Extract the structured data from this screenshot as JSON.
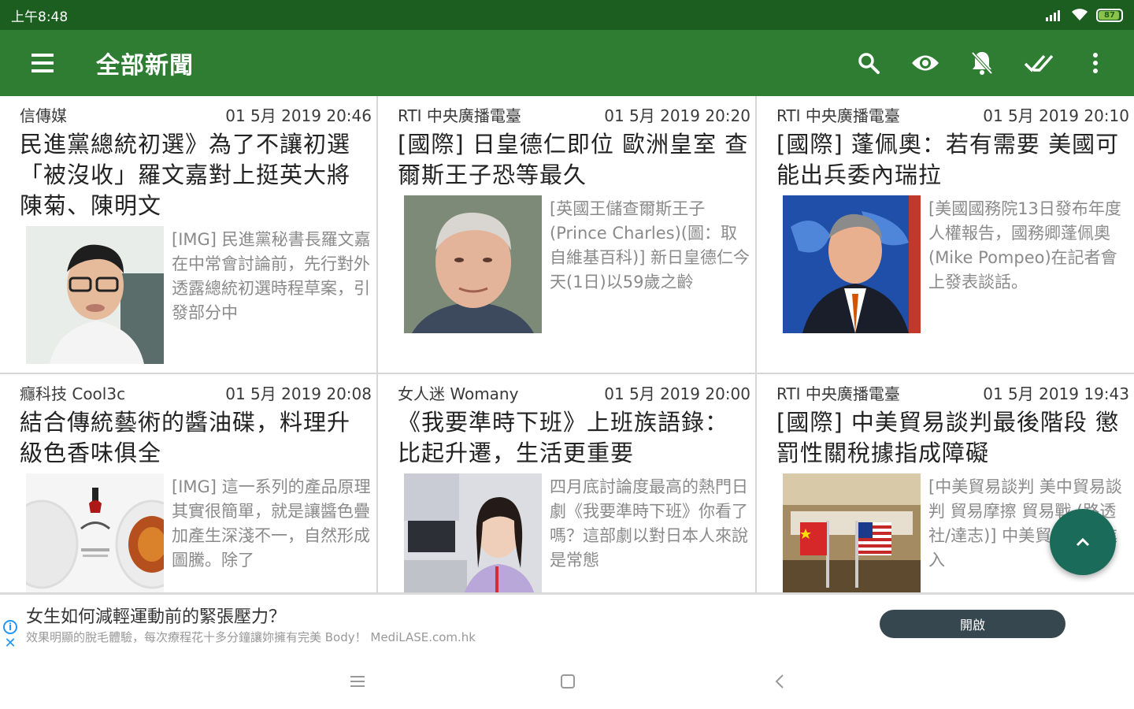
{
  "status_bar": {
    "time": "上午8:48",
    "battery": "87"
  },
  "app_bar": {
    "title": "全部新聞",
    "actions": [
      "search-icon",
      "eye-icon",
      "notifications-off-icon",
      "done-all-icon",
      "more-vert-icon"
    ]
  },
  "articles": [
    {
      "source": "信傳媒",
      "date": "01 5月 2019 20:46",
      "title": "民進黨總統初選》為了不讓初選「被沒收」羅文嘉對上挺英大將陳菊、陳明文",
      "snippet": "[IMG] 民進黨秘書長羅文嘉在中常會討論前，先行對外透露總統初選時程草案，引發部分中"
    },
    {
      "source": "RTI 中央廣播電臺",
      "date": "01 5月 2019 20:20",
      "title": "[國際] 日皇德仁即位 歐洲皇室 查爾斯王子恐等最久",
      "snippet": "[英國王儲查爾斯王子(Prince Charles)(圖：取自維基百科)] 新日皇德仁今天(1日)以59歲之齡"
    },
    {
      "source": "RTI 中央廣播電臺",
      "date": "01 5月 2019 20:10",
      "title": "[國際] 蓬佩奧：若有需要 美國可能出兵委內瑞拉",
      "snippet": "[美國國務院13日發布年度人權報告，國務卿蓬佩奧(Mike Pompeo)在記者會上發表談話。"
    },
    {
      "source": "癮科技 Cool3c",
      "date": "01 5月 2019 20:08",
      "title": "結合傳統藝術的醬油碟，料理升級色香味俱全",
      "snippet": "[IMG] 這一系列的產品原理其實很簡單，就是讓醬色疊加產生深淺不一，自然形成圖騰。除了"
    },
    {
      "source": "女人迷 Womany",
      "date": "01 5月 2019 20:00",
      "title": "《我要準時下班》上班族語錄：比起升遷，生活更重要",
      "snippet": "四月底討論度最高的熱門日劇《我要準時下班》你看了嗎？這部劇以對日本人來說是常態"
    },
    {
      "source": "RTI 中央廣播電臺",
      "date": "01 5月 2019 19:43",
      "title": "[國際] 中美貿易談判最後階段 懲罰性關稅據指成障礙",
      "snippet": "[中美貿易談判 美中貿易談判 貿易摩擦 貿易戰 (路透社/達志)] 中美貿易談判進入"
    }
  ],
  "ad": {
    "title": "女生如何減輕運動前的緊張壓力？",
    "description": "效果明顯的脫毛體驗，每次療程花十多分鐘讓妳擁有完美 Body！ MediLASE.com.hk",
    "button_label": "開啟"
  },
  "colors": {
    "status_bar": "#1b5e20",
    "app_bar": "#2e7d32",
    "fab": "#1b6b5b",
    "ad_button": "#37474f"
  }
}
